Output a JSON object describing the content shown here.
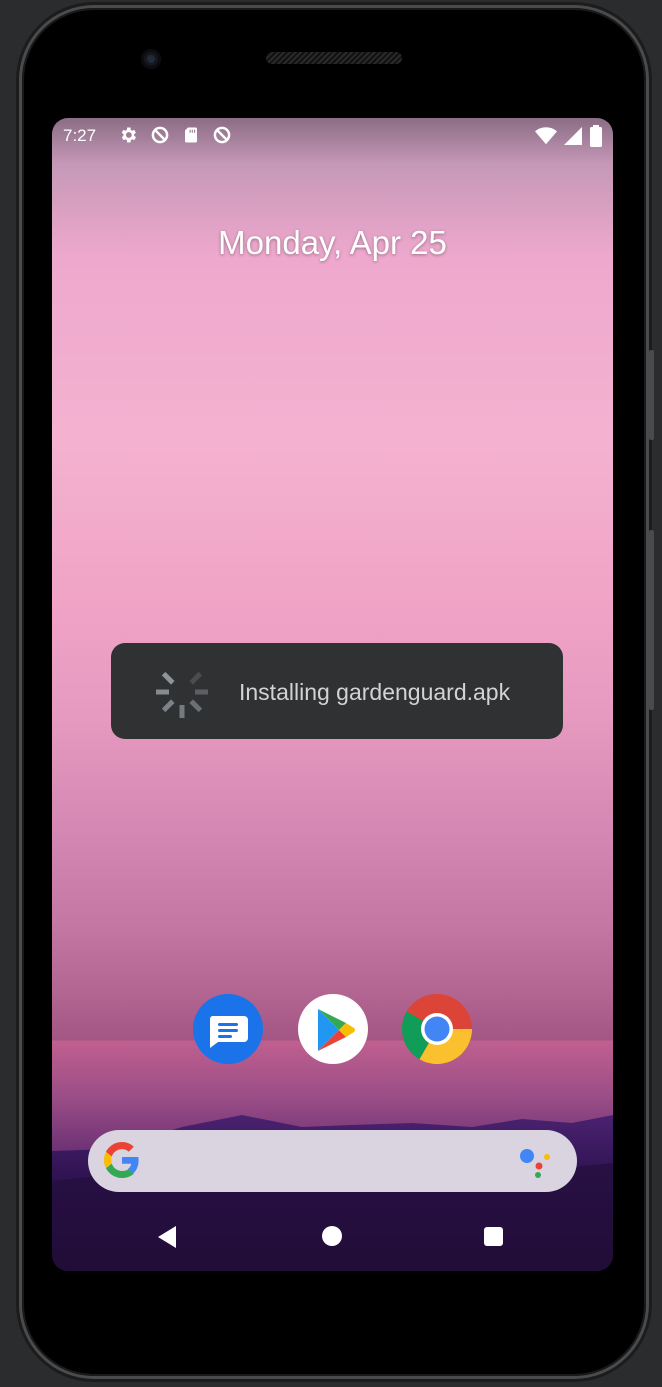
{
  "status_bar": {
    "time": "7:27",
    "left_icons": [
      "gear-icon",
      "no-entry-icon",
      "sd-card-icon",
      "no-entry-icon"
    ],
    "right_icons": [
      "wifi-icon",
      "signal-icon",
      "battery-icon"
    ]
  },
  "home": {
    "date": "Monday, Apr 25"
  },
  "toast": {
    "icon": "loading-spinner-icon",
    "message": "Installing gardenguard.apk"
  },
  "dock": {
    "apps": [
      {
        "name": "Messages",
        "icon": "messages-icon"
      },
      {
        "name": "Play Store",
        "icon": "play-store-icon"
      },
      {
        "name": "Chrome",
        "icon": "chrome-icon"
      }
    ]
  },
  "search": {
    "icon": "google-g-icon",
    "assistant_icon": "google-assistant-icon"
  },
  "navigation": {
    "buttons": [
      "back-icon",
      "home-icon",
      "recents-icon"
    ]
  },
  "colors": {
    "toast_bg": "#303133",
    "searchbar_bg": "#d9d4df",
    "messages_blue": "#1a73e8"
  }
}
